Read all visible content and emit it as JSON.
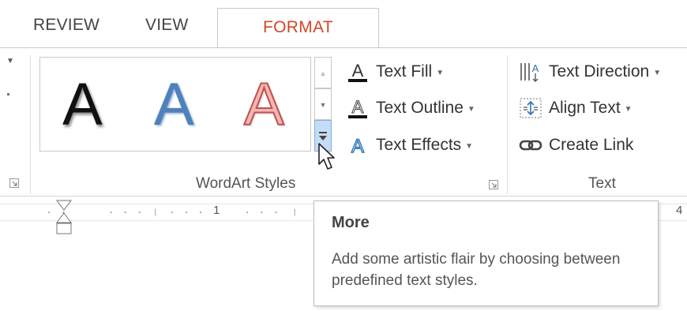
{
  "tabs": {
    "review": "REVIEW",
    "view": "VIEW",
    "format": "FORMAT",
    "active_color": "#d24726"
  },
  "wordart_gallery": {
    "styles": [
      {
        "glyph": "A",
        "color": "#111111"
      },
      {
        "glyph": "A",
        "color": "#4f81bd"
      },
      {
        "glyph": "A",
        "color": "#f2b7b4"
      }
    ]
  },
  "wordart_group": {
    "label": "WordArt Styles",
    "text_fill": "Text Fill",
    "text_outline": "Text Outline",
    "text_effects": "Text Effects"
  },
  "text_group": {
    "label": "Text",
    "text_direction": "Text Direction",
    "align_text": "Align Text",
    "create_link": "Create Link"
  },
  "ruler": {
    "mark_1": "1",
    "mark_4": "4"
  },
  "tooltip": {
    "title": "More",
    "description": "Add some artistic flair by choosing between predefined text styles."
  },
  "icons": [
    "text-fill-icon",
    "text-outline-icon",
    "text-effects-icon",
    "text-direction-icon",
    "align-text-icon",
    "create-link-icon",
    "more-icon",
    "scroll-up-icon",
    "scroll-down-icon",
    "dialog-launcher-icon",
    "mouse-cursor-icon",
    "indent-marker-icon"
  ]
}
